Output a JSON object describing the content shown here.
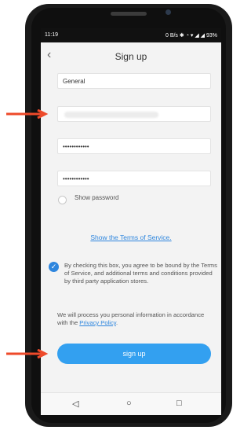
{
  "statusbar": {
    "time": "11:19",
    "right": "0 B/s ✱ ◔ ▾ ◢ ◢ 93%"
  },
  "header": {
    "title": "Sign up"
  },
  "form": {
    "field1": "General",
    "field3": "••••••••••••",
    "field4": "••••••••••••",
    "show_password": "Show password"
  },
  "terms": {
    "link": "Show the Terms of Service.",
    "agreement": "By checking this box, you agree to be bound by the Terms of Service, and additional terms and conditions provided by third party application stores.",
    "privacy_prefix": "We will process you personal information in accordance with the ",
    "privacy_link": "Privacy Policy",
    "privacy_suffix": "."
  },
  "actions": {
    "signup": "sign up"
  },
  "nav": {
    "back": "◁",
    "home": "○",
    "recent": "□"
  },
  "colors": {
    "accent": "#33a0f0",
    "arrow": "#ee4a2a"
  }
}
